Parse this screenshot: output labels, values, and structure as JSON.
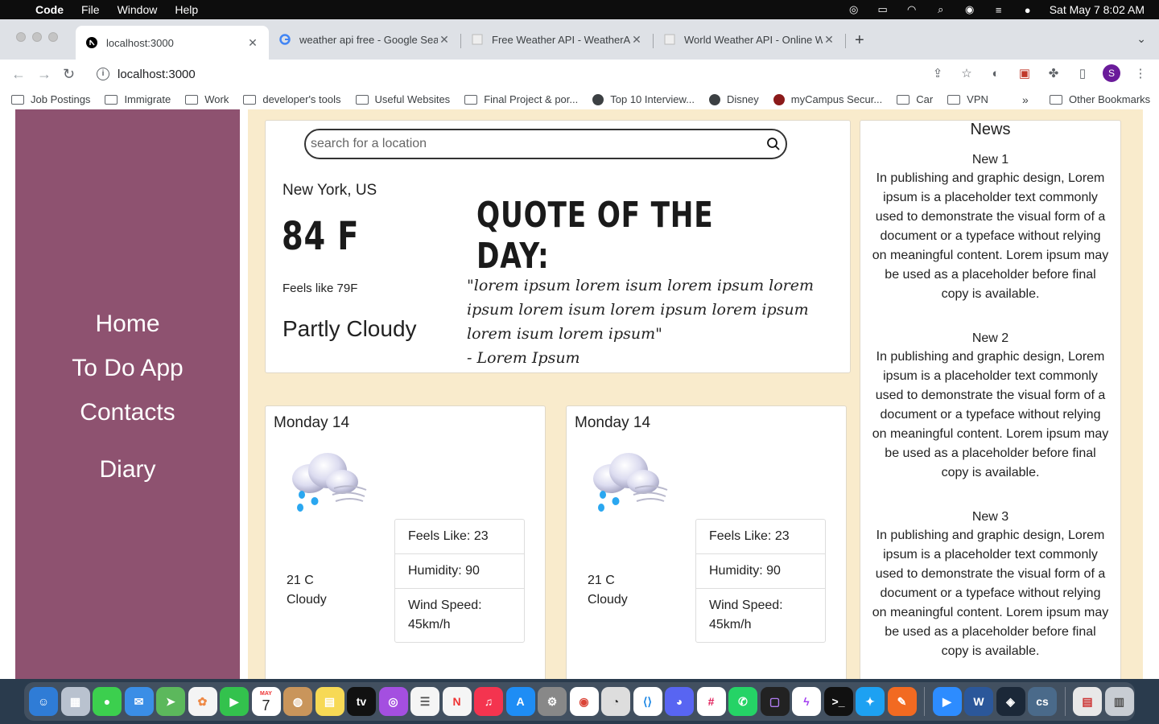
{
  "menubar": {
    "app_name": "Code",
    "menus": [
      "File",
      "Window",
      "Help"
    ],
    "clock": "Sat May 7  8:02 AM"
  },
  "browser": {
    "tabs": [
      {
        "title": "localhost:3000",
        "active": true
      },
      {
        "title": "weather api free - Google Sear",
        "active": false
      },
      {
        "title": "Free Weather API - WeatherAP",
        "active": false
      },
      {
        "title": "World Weather API - Online We",
        "active": false
      }
    ],
    "url": "localhost:3000",
    "profile_initial": "S",
    "bookmarks": [
      {
        "label": "Job Postings",
        "icon": "folder-icon"
      },
      {
        "label": "Immigrate",
        "icon": "folder-icon"
      },
      {
        "label": "Work",
        "icon": "folder-icon"
      },
      {
        "label": "developer's tools",
        "icon": "folder-icon"
      },
      {
        "label": "Useful Websites",
        "icon": "folder-icon"
      },
      {
        "label": "Final Project & por...",
        "icon": "folder-icon"
      },
      {
        "label": "Top 10 Interview...",
        "icon": "globe-icon"
      },
      {
        "label": "Disney",
        "icon": "globe-icon"
      },
      {
        "label": "myCampus Secur...",
        "icon": "globe-icon"
      },
      {
        "label": "Car",
        "icon": "folder-icon"
      },
      {
        "label": "VPN",
        "icon": "folder-icon"
      }
    ],
    "other_bookmarks": "Other Bookmarks"
  },
  "sidebar": {
    "links": [
      "Home",
      "To Do App",
      "Contacts",
      "Diary"
    ]
  },
  "weather": {
    "search_placeholder": "search for a location",
    "location": "New York, US",
    "temperature": "84 F",
    "feels_like": "Feels like 79F",
    "condition": "Partly Cloudy"
  },
  "quote": {
    "heading": "QUOTE OF THE DAY:",
    "text": "\"lorem ipsum lorem isum lorem ipsum lorem ipsum lorem isum lorem ipsum lorem ipsum lorem isum lorem ipsum\"",
    "author": "- Lorem Ipsum"
  },
  "forecast": [
    {
      "day": "Monday 14",
      "temp": "21 C",
      "condition": "Cloudy",
      "feels_like": "Feels Like: 23",
      "humidity": "Humidity: 90",
      "wind": "Wind Speed: 45km/h"
    },
    {
      "day": "Monday 14",
      "temp": "21 C",
      "condition": "Cloudy",
      "feels_like": "Feels Like: 23",
      "humidity": "Humidity: 90",
      "wind": "Wind Speed: 45km/h"
    }
  ],
  "news": {
    "heading": "News",
    "items": [
      {
        "title": "New 1",
        "body": "In publishing and graphic design, Lorem ipsum is a placeholder text commonly used to demonstrate the visual form of a document or a typeface without relying on meaningful content. Lorem ipsum may be used as a placeholder before final copy is available."
      },
      {
        "title": "New 2",
        "body": "In publishing and graphic design, Lorem ipsum is a placeholder text commonly used to demonstrate the visual form of a document or a typeface without relying on meaningful content. Lorem ipsum may be used as a placeholder before final copy is available."
      },
      {
        "title": "New 3",
        "body": "In publishing and graphic design, Lorem ipsum is a placeholder text commonly used to demonstrate the visual form of a document or a typeface without relying on meaningful content. Lorem ipsum may be used as a placeholder before final copy is available."
      }
    ]
  },
  "colors": {
    "sidebar": "#8e5270",
    "content_bg": "#f9ebcc"
  },
  "dock": {
    "calendar_month": "MAY",
    "calendar_day": "7",
    "apps": [
      "finder-icon",
      "launchpad-icon",
      "messages-icon",
      "mail-icon",
      "maps-icon",
      "photos-icon",
      "facetime-icon",
      "calendar-icon",
      "contacts-icon",
      "notes-icon",
      "tv-icon",
      "podcasts-icon",
      "reminders-icon",
      "news-icon",
      "music-icon",
      "appstore-icon",
      "settings-icon",
      "chrome-icon",
      "proxyman-icon",
      "vscode-icon",
      "discord-icon",
      "slack-icon",
      "whatsapp-icon",
      "screen-icon",
      "messenger-icon",
      "terminal-icon",
      "twitter-icon",
      "sketch-icon",
      "zoom-icon",
      "word-icon",
      "steam-icon",
      "cs-icon",
      "preview-icon",
      "trash-icon"
    ]
  }
}
